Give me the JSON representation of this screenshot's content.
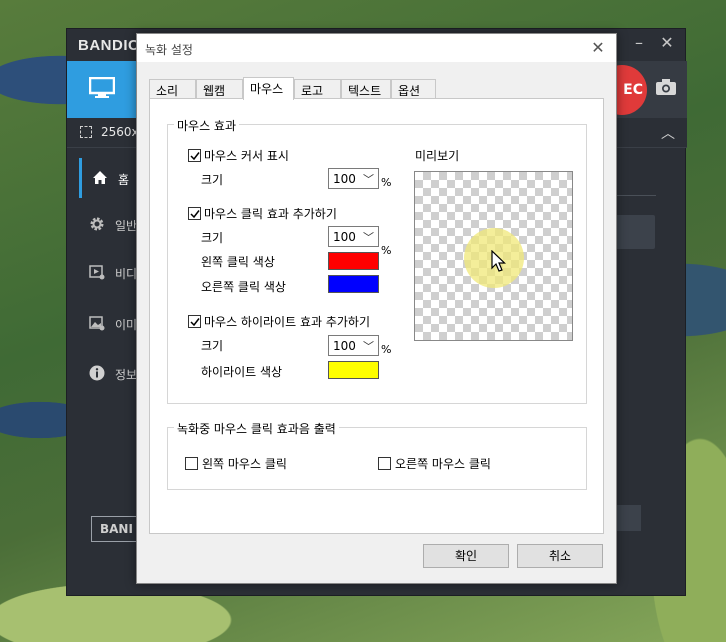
{
  "bandicam": {
    "logo": "BANDIC",
    "rec_label": "EC",
    "resolution": "2560x",
    "sidebar": [
      {
        "label": "홈",
        "icon": "home-icon"
      },
      {
        "label": "일반",
        "icon": "gear-icon"
      },
      {
        "label": "비디",
        "icon": "video-settings-icon"
      },
      {
        "label": "이미",
        "icon": "image-settings-icon"
      },
      {
        "label": "정보",
        "icon": "info-icon"
      }
    ],
    "banner": "BANI"
  },
  "dialog": {
    "title": "녹화 설정",
    "tabs": [
      {
        "label": "소리"
      },
      {
        "label": "웹캠"
      },
      {
        "label": "마우스"
      },
      {
        "label": "로고"
      },
      {
        "label": "텍스트"
      },
      {
        "label": "옵션"
      }
    ],
    "active_tab": "마우스",
    "mouse_effects": {
      "group_title": "마우스 효과",
      "cursor": {
        "label": "마우스 커서 표시",
        "checked": true,
        "size_label": "크기",
        "size": "100"
      },
      "click": {
        "label": "마우스 클릭 효과 추가하기",
        "checked": true,
        "size_label": "크기",
        "size": "100",
        "left_label": "왼쪽 클릭 색상",
        "left_color": "#ff0000",
        "right_label": "오른쪽 클릭 색상",
        "right_color": "#0000ff"
      },
      "highlight": {
        "label": "마우스 하이라이트 효과 추가하기",
        "checked": true,
        "size_label": "크기",
        "size": "100",
        "color_label": "하이라이트 색상",
        "color": "#ffff00"
      },
      "percent": "%",
      "preview_label": "미리보기"
    },
    "click_sound": {
      "group_title": "녹화중 마우스 클릭 효과음 출력",
      "left": {
        "label": "왼쪽 마우스 클릭",
        "checked": false
      },
      "right": {
        "label": "오른쪽 마우스 클릭",
        "checked": false
      }
    },
    "ok_label": "확인",
    "cancel_label": "취소"
  }
}
